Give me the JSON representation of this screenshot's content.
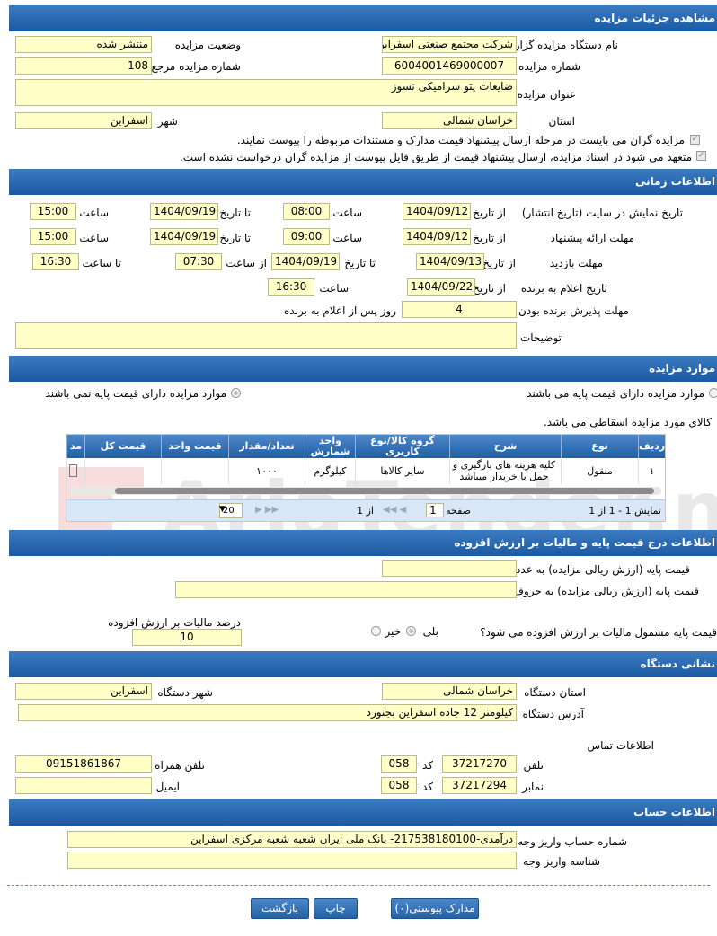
{
  "colors": {
    "header": "#2a67ab",
    "input_bg": "#ffffc8",
    "accent": "#1b5aa3"
  },
  "watermark": "AriaTender.net",
  "s1": {
    "title": "مشاهده جزئیات مزایده",
    "org_label": "نام دستگاه مزایده گزار",
    "org_value": "شرکت مجتمع صنعتی اسفراین",
    "status_label": "وضعیت مزایده",
    "status_value": "منتشر شده",
    "num_label": "شماره مزایده",
    "num_value": "6004001469000007",
    "ref_label": "شماره مزایده مرجع",
    "ref_value": "108",
    "subject_label": "عنوان مزایده",
    "subject_value": "ضایعات پتو سرامیکی نسوز",
    "province_label": "استان",
    "province_value": "خراسان شمالی",
    "city_label": "شهر",
    "city_value": "اسفراین",
    "note1": "مزایده گران می بایست در مرحله ارسال پیشنهاد قیمت مدارک و مستندات مربوطه را پیوست نمایند.",
    "note2": "متعهد می شود در اسناد مزایده، ارسال پیشنهاد قیمت از طریق فایل پیوست از مزایده گران درخواست نشده است."
  },
  "s2": {
    "title": "اطلاعات زمانی",
    "display_label": "تاریخ نمایش در سایت (تاریخ انتشار)",
    "display_from": "1404/09/12",
    "display_from_time": "08:00",
    "display_to": "1404/09/19",
    "display_to_time": "15:00",
    "offer_label": "مهلت ارائه پیشنهاد",
    "offer_from": "1404/09/12",
    "offer_from_time": "09:00",
    "offer_to": "1404/09/19",
    "offer_to_time": "15:00",
    "visit_label": "مهلت بازدید",
    "visit_from": "1404/09/13",
    "visit_to": "1404/09/19",
    "visit_from_time": "07:30",
    "visit_to_time": "16:30",
    "announce_label": "تاریخ اعلام به برنده",
    "announce_date": "1404/09/22",
    "announce_time": "16:30",
    "accept_label": "مهلت پذیرش برنده بودن",
    "accept_value": "4",
    "accept_suffix": "روز پس از اعلام به برنده",
    "desc_label": "توضیحات",
    "from_date": "از تاریخ",
    "to_date": "تا تاریخ",
    "time": "ساعت",
    "from_time": "از ساعت",
    "to_time": "تا ساعت"
  },
  "s3": {
    "title": "موارد مزایده",
    "opt1": "موارد مزایده دارای قیمت پایه می باشند",
    "opt2": "موارد مزایده دارای قیمت پایه نمی باشند",
    "note": "کالای مورد مزایده اسقاطی می باشد.",
    "cols": [
      "ردیف",
      "نوع",
      "شرح",
      "گروه کالا/نوع کاربری",
      "واحد شمارش",
      "تعداد/مقدار",
      "قیمت واحد",
      "قیمت کل",
      "مد"
    ],
    "row": [
      "۱",
      "منقول",
      "کلیه هزینه های بارگیری و حمل با خریدار میباشد",
      "سایر کالاها",
      "کیلوگرم",
      "۱۰۰۰",
      "",
      "",
      ""
    ],
    "pager_info": "نمایش 1 - 1 از 1",
    "page_label": "صفحه",
    "page_value": "1",
    "of_label": "از 1",
    "page_size": "20"
  },
  "s4": {
    "title": "اطلاعات درج قیمت پایه و مالیات بر ارزش افزوده",
    "base_num_label": "قیمت پایه (ارزش ریالی مزایده) به عدد",
    "base_text_label": "قیمت پایه (ارزش ریالی مزایده) به حروف",
    "vat_q": "قیمت پایه مشمول مالیات بر ارزش افزوده می شود؟",
    "yes": "بلی",
    "no": "خیر",
    "vat_pct_label": "درصد مالیات بر ارزش افزوده",
    "vat_pct_value": "10"
  },
  "s5": {
    "title": "نشانی دستگاه",
    "province_label": "استان دستگاه",
    "province_value": "خراسان شمالی",
    "city_label": "شهر دستگاه",
    "city_value": "اسفراین",
    "address_label": "آدرس دستگاه",
    "address_value": "کیلومتر 12 جاده اسفراین بجنورد",
    "contact_label": "اطلاعات تماس",
    "phone_label": "تلفن",
    "phone_value": "37217270",
    "code_label": "کد",
    "phone_code": "058",
    "fax_label": "نمابر",
    "fax_value": "37217294",
    "fax_code": "058",
    "mobile_label": "تلفن همراه",
    "mobile_value": "09151861867",
    "email_label": "ایمیل",
    "email_value": ""
  },
  "s6": {
    "title": "اطلاعات حساب",
    "account_label": "شماره حساب واریز وجه",
    "account_value": "درآمدی-217538180100- بانک ملی ایران شعبه شعبه مرکزی اسفراین",
    "id_label": "شناسه واریز وجه",
    "id_value": ""
  },
  "buttons": {
    "attachments": "مدارک پیوستی(۰)",
    "print": "چاپ",
    "back": "بازگشت"
  }
}
